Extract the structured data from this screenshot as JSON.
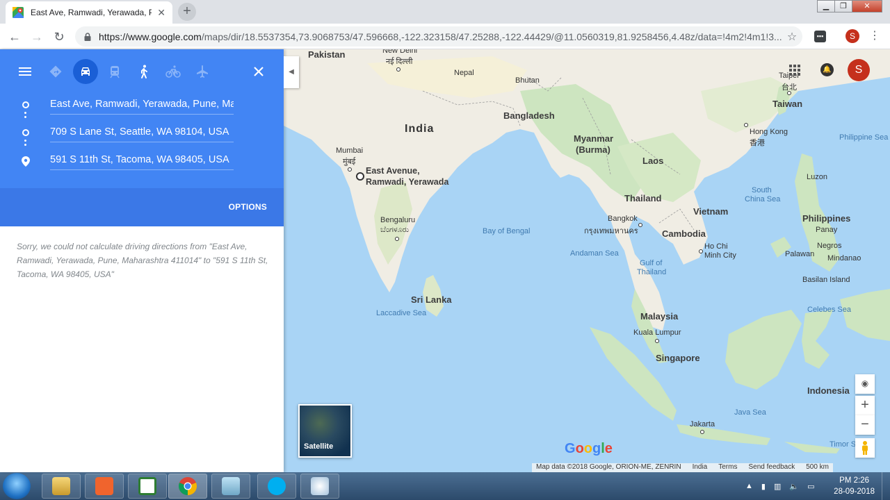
{
  "browser": {
    "tab_title": "East Ave, Ramwadi, Yerawada, Pu",
    "url_host": "https://www.google.com",
    "url_path": "/maps/dir/18.5537354,73.9068753/47.596668,-122.323158/47.25288,-122.44429/@11.0560319,81.9258456,4.48z/data=!4m2!4m1!3...",
    "profile_initial": "S"
  },
  "directions": {
    "waypoints": [
      "East Ave, Ramwadi, Yerawada, Pune, Maharashtra",
      "709 S Lane St, Seattle, WA 98104, USA",
      "591 S 11th St, Tacoma, WA 98405, USA"
    ],
    "options_label": "OPTIONS",
    "error_message": "Sorry, we could not calculate driving directions from \"East Ave, Ramwadi, Yerawada, Pune, Maharashtra 411014\" to \"591 S 11th St, Tacoma, WA 98405, USA\""
  },
  "map": {
    "labels": {
      "pakistan": "Pakistan",
      "new_delhi": "New Delhi",
      "new_delhi_hi": "नई दिल्ली",
      "nepal": "Nepal",
      "bhutan": "Bhutan",
      "bangladesh": "Bangladesh",
      "india": "India",
      "mumbai": "Mumbai",
      "mumbai_mr": "मुंबई",
      "origin": "East Avenue,",
      "origin2": "Ramwadi, Yerawada",
      "myanmar": "Myanmar",
      "burma": "(Burma)",
      "laos": "Laos",
      "thailand": "Thailand",
      "vietnam": "Vietnam",
      "bangkok": "Bangkok",
      "bangkok_th": "กรุงเทพมหานคร",
      "cambodia": "Cambodia",
      "ho_chi_minh": "Ho Chi",
      "ho_chi_minh2": "Minh City",
      "bengaluru": "Bengaluru",
      "bengaluru_kn": "ಬೆಂಗಳೂರು",
      "bay_of_bengal": "Bay of Bengal",
      "andaman_sea": "Andaman Sea",
      "gulf_of_thailand": "Gulf of",
      "gulf_of_thailand2": "Thailand",
      "sri_lanka": "Sri Lanka",
      "laccadive_sea": "Laccadive Sea",
      "malaysia": "Malaysia",
      "kuala_lumpur": "Kuala Lumpur",
      "singapore": "Singapore",
      "taipei": "Taipei",
      "taipei_zh": "台北",
      "taiwan": "Taiwan",
      "hong_kong": "Hong Kong",
      "hong_kong_zh": "香港",
      "philippine_sea": "Philippine Sea",
      "south_china_sea": "South",
      "south_china_sea2": "China Sea",
      "luzon": "Luzon",
      "philippines": "Philippines",
      "panay": "Panay",
      "negros": "Negros",
      "palawan": "Palawan",
      "mindanao": "Mindanao",
      "basilan": "Basilan Island",
      "celebes_sea": "Celebes Sea",
      "indonesia": "Indonesia",
      "java_sea": "Java Sea",
      "jakarta": "Jakarta",
      "timor": "Timor S"
    },
    "satellite_label": "Satellite",
    "google_logo": "Google",
    "attribution": {
      "data": "Map data ©2018 Google, ORION-ME, ZENRIN",
      "region": "India",
      "terms": "Terms",
      "feedback": "Send feedback",
      "scale": "500 km"
    },
    "account_initial": "S"
  },
  "taskbar": {
    "time": "PM 2:26",
    "date": "28-09-2018"
  },
  "colors": {
    "directions_blue": "#4285f4",
    "options_blue": "#3b78e7",
    "water": "#a9d4f5",
    "land": "#f0ede4",
    "forest": "#cde5c0",
    "account_red": "#c5301c"
  }
}
